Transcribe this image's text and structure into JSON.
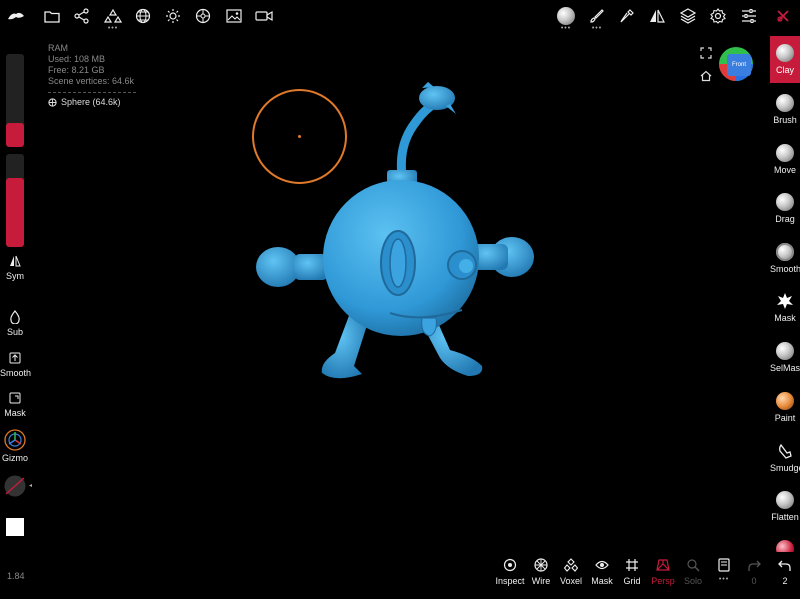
{
  "app": {
    "version": "1.84"
  },
  "top_toolbar": {
    "left_icons": [
      "nomad-logo-icon",
      "folder-icon",
      "scene-graph-icon",
      "primitives-icon",
      "topology-icon",
      "lighting-icon",
      "material-icon",
      "background-image-icon",
      "video-icon"
    ],
    "right_icons": [
      "matcap-sphere-icon",
      "paint-brush-icon",
      "eyedropper-icon",
      "symmetry-icon",
      "layers-icon",
      "settings-icon",
      "sliders-icon",
      "close-red-icon"
    ]
  },
  "info_panel": {
    "ram_label": "RAM",
    "used": "Used:  108 MB",
    "free": "Free:  8.21 GB",
    "scene_vertices": "Scene vertices:  64.6k",
    "mesh_name": "Sphere (64.6k)"
  },
  "left_sliders": {
    "radius_level": 0.26,
    "intensity_level": 0.74
  },
  "left_tools": [
    {
      "label": "Sym"
    },
    {
      "label": "Sub"
    },
    {
      "label": "Smooth"
    },
    {
      "label": "Mask"
    },
    {
      "label": "Gizmo"
    }
  ],
  "colors": {
    "accent_red": "#c61b3a",
    "model_blue": "#3aa3e0",
    "cursor_orange": "#e07a2a",
    "swatch": "#ffffff"
  },
  "view_cube": {
    "label": "Front"
  },
  "right_tools": [
    {
      "label": "Clay",
      "active": true
    },
    {
      "label": "Brush"
    },
    {
      "label": "Move"
    },
    {
      "label": "Drag"
    },
    {
      "label": "Smooth"
    },
    {
      "label": "Mask"
    },
    {
      "label": "SelMask"
    },
    {
      "label": "Paint"
    },
    {
      "label": "Smudge"
    },
    {
      "label": "Flatten"
    }
  ],
  "bottom_tools": [
    {
      "label": "Inspect"
    },
    {
      "label": "Wire"
    },
    {
      "label": "Voxel"
    },
    {
      "label": "Mask"
    },
    {
      "label": "Grid"
    },
    {
      "label": "Persp",
      "active": true
    },
    {
      "label": "Solo",
      "disabled": true
    }
  ],
  "history": {
    "redo_count": "0",
    "undo_count": "2"
  }
}
